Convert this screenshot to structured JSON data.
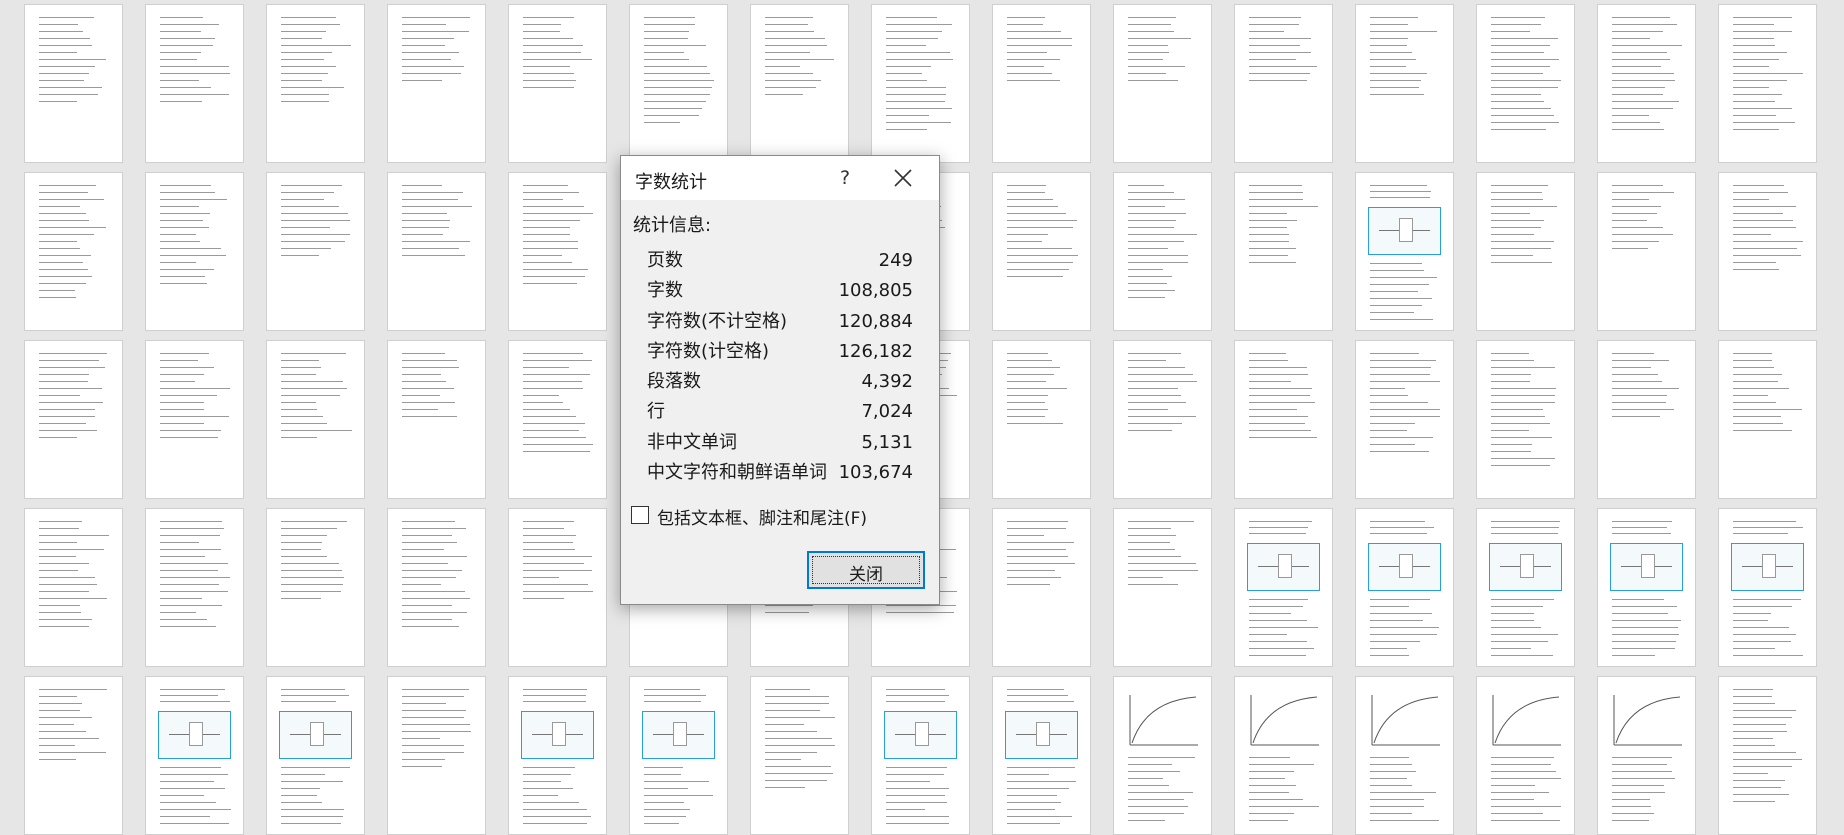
{
  "dialog": {
    "title": "字数统计",
    "help_label": "?",
    "stats_heading": "统计信息:",
    "stats": [
      {
        "label": "页数",
        "value": "249"
      },
      {
        "label": "字数",
        "value": "108,805"
      },
      {
        "label": "字符数(不计空格)",
        "value": "120,884"
      },
      {
        "label": "字符数(计空格)",
        "value": "126,182"
      },
      {
        "label": "段落数",
        "value": "4,392"
      },
      {
        "label": "行",
        "value": "7,024"
      },
      {
        "label": "非中文单词",
        "value": "5,131"
      },
      {
        "label": "中文字符和朝鲜语单词",
        "value": "103,674"
      }
    ],
    "include_checkbox": {
      "label": "包括文本框、脚注和尾注(F)",
      "checked": false
    },
    "close_button_label": "关闭"
  },
  "document_view": {
    "rows": 5,
    "columns": 15,
    "figure_pages": [
      [
        1,
        11
      ],
      [
        3,
        10
      ],
      [
        3,
        11
      ],
      [
        3,
        12
      ],
      [
        3,
        13
      ],
      [
        3,
        14
      ],
      [
        4,
        1
      ],
      [
        4,
        2
      ],
      [
        4,
        4
      ],
      [
        4,
        5
      ],
      [
        4,
        7
      ],
      [
        4,
        8
      ]
    ],
    "graph_pages": [
      [
        4,
        9
      ],
      [
        4,
        10
      ],
      [
        4,
        11
      ],
      [
        4,
        12
      ],
      [
        4,
        13
      ]
    ],
    "accent_color": "#28a0d8",
    "dialog_focus_color": "#0078d7"
  }
}
